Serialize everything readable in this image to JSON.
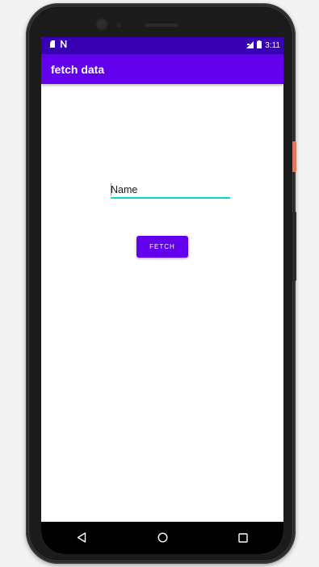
{
  "status_bar": {
    "time": "3:11",
    "background_color": "#3700b3",
    "left_icons": [
      "notification-n-icon",
      "sim-icon"
    ],
    "right_icons": [
      "signal-icon",
      "battery-icon"
    ]
  },
  "app_bar": {
    "title": "fetch data",
    "background_color": "#6200ee"
  },
  "form": {
    "name_input": {
      "placeholder": "Name",
      "value": ""
    },
    "fetch_button_label": "FETCH"
  },
  "colors": {
    "accent": "#03dac5",
    "primary": "#6200ee",
    "primary_dark": "#3700b3"
  },
  "nav_bar": {
    "icons": [
      "back-icon",
      "home-icon",
      "recents-icon"
    ]
  }
}
